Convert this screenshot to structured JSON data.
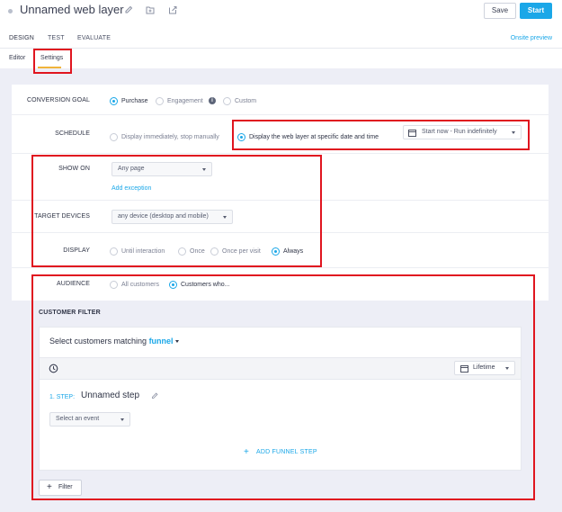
{
  "header": {
    "title": "Unnamed web layer",
    "save_label": "Save",
    "start_label": "Start",
    "tabs": [
      "DESIGN",
      "TEST",
      "EVALUATE"
    ],
    "onsite_preview": "Onsite preview",
    "subtabs": [
      "Editor",
      "Settings"
    ]
  },
  "settings": {
    "conversion_goal": {
      "label": "CONVERSION GOAL",
      "options": [
        "Purchase",
        "Engagement",
        "Custom"
      ],
      "selected": "Purchase",
      "info_icon": "i"
    },
    "schedule": {
      "label": "SCHEDULE",
      "option_immediate": "Display immediately, stop manually",
      "option_specific": "Display the web layer at specific date and time",
      "selected": "specific",
      "date_select": "Start now - Run indefinitely"
    },
    "show_on": {
      "label": "SHOW ON",
      "select": "Any page",
      "add_exception": "Add exception"
    },
    "target_devices": {
      "label": "TARGET DEVICES",
      "select": "any device (desktop and mobile)"
    },
    "display": {
      "label": "DISPLAY",
      "options": [
        "Until interaction",
        "Once",
        "Once per visit",
        "Always"
      ],
      "selected": "Always"
    },
    "audience": {
      "label": "AUDIENCE",
      "options": [
        "All customers",
        "Customers who..."
      ],
      "selected": "Customers who..."
    }
  },
  "customer_filter": {
    "title": "CUSTOMER FILTER",
    "matching_prefix": "Select customers matching",
    "matching_value": "funnel",
    "lifetime": "Lifetime",
    "step_number": "1. STEP:",
    "step_name": "Unnamed step",
    "event_select": "Select an event",
    "add_step": "ADD FUNNEL STEP",
    "filter_button": "Filter"
  },
  "colors": {
    "accent": "#1aa7e8",
    "highlight_box": "#e0151f",
    "subtab_underline": "#f1b43b",
    "background": "#edeef6"
  },
  "icons": [
    "pencil-icon",
    "folder-icon",
    "export-icon",
    "calendar-icon",
    "clock-icon",
    "plus-icon",
    "info-icon"
  ]
}
